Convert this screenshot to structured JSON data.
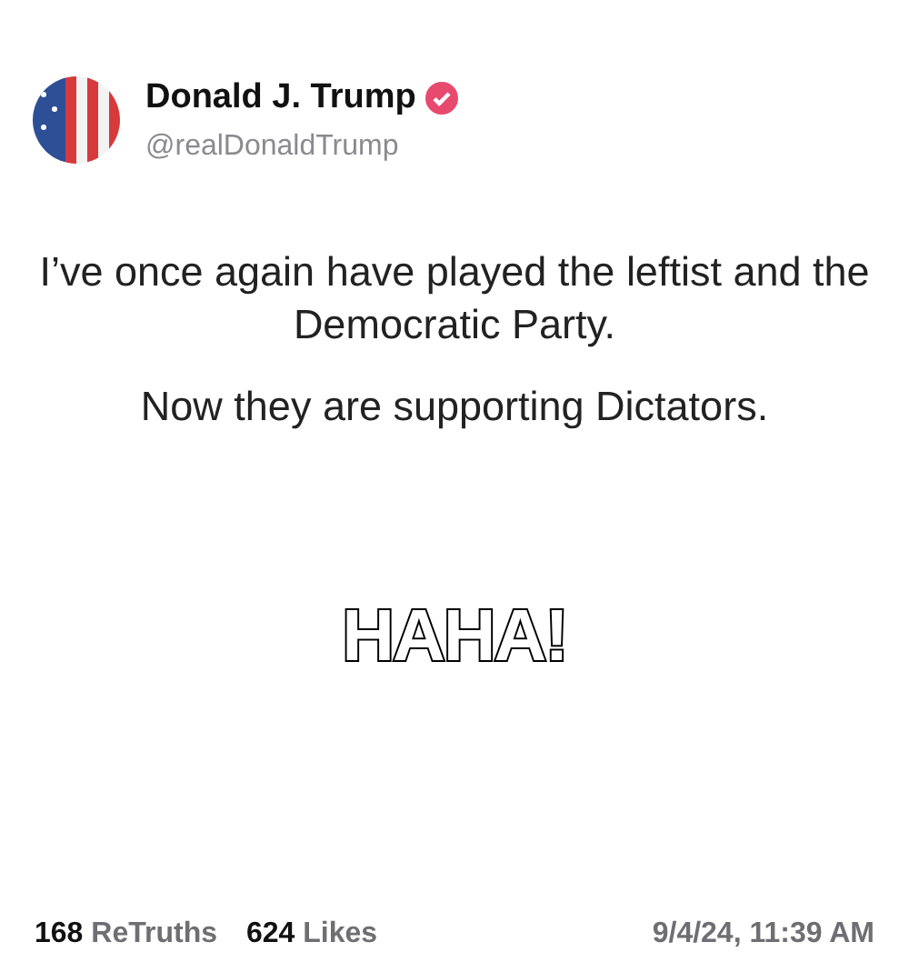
{
  "author": {
    "name": "Donald J. Trump",
    "verified": true,
    "handle": "@realDonaldTrump"
  },
  "paragraphs": [
    "I’ve once again have played the leftist and the Democratic Party.",
    "Now they are supporting Dictators."
  ],
  "caption": "HAHA!",
  "stats": [
    {
      "count": "168",
      "label": "ReTruths"
    },
    {
      "count": "624",
      "label": "Likes"
    }
  ],
  "timestamp": "9/4/24, 11:39 AM"
}
